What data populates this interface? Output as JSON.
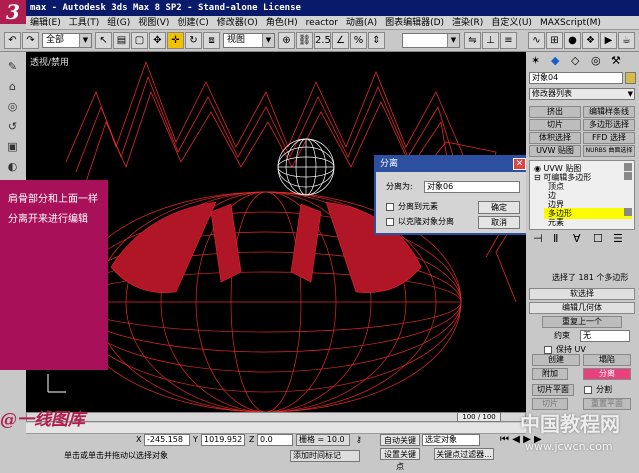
{
  "app": {
    "logo_text": "3",
    "window_title": "max - Autodesk 3ds Max 8 SP2  - Stand-alone License"
  },
  "menu": [
    "编辑(E)",
    "工具(T)",
    "组(G)",
    "视图(V)",
    "创建(C)",
    "修改器(O)",
    "角色(H)",
    "reactor",
    "动画(A)",
    "图表编辑器(D)",
    "渲染(R)",
    "自定义(U)",
    "MAXScript(M)",
    "帮助(H)"
  ],
  "toolbar": {
    "selection_filter": "全部",
    "view_select": "视图",
    "snap_label": "2.5"
  },
  "viewport": {
    "label": "透视/禁用"
  },
  "note": {
    "lines": [
      "肩骨部分和上面一样",
      "分离开来进行编辑"
    ]
  },
  "dialog": {
    "title": "分离",
    "name_label": "分离为:",
    "name_value": "对象06",
    "option_element": "分离到元素",
    "option_clone": "以克隆对象分离",
    "ok_label": "确定",
    "cancel_label": "取消"
  },
  "panel": {
    "object_name": "对象04",
    "modifier_list": "修改器列表",
    "buttons": [
      [
        "挤出",
        "编辑样条线"
      ],
      [
        "切片",
        "多边形选择"
      ],
      [
        "体积选择",
        "FFD 选择"
      ],
      [
        "UVW 贴图",
        "NURBS 曲面选择"
      ]
    ],
    "stack": [
      "UVW 贴图",
      "可编辑多边形",
      "顶点",
      "边",
      "边界",
      "多边形",
      "元素"
    ],
    "selected_status": "选择了 181 个多边形",
    "soft_selection": "软选择",
    "edit_geometry": "编辑几何体",
    "repeat_last": "重复上一个",
    "constraint_label": "约束",
    "constraint_value": "无",
    "preserve_uv": "保持 UV",
    "create_label": "创建",
    "collapse_label": "塌陷",
    "attach_label": "附加",
    "detach_label": "分离",
    "slice_plane": "切片平面",
    "split_label": "分割",
    "slice_label": "切片",
    "reset_plane": "重置平面"
  },
  "bottom": {
    "timeline": "100 / 100",
    "x_label": "X",
    "x_value": "-245.158",
    "y_label": "Y",
    "y_value": "1019.952",
    "z_label": "Z",
    "z_value": "0.0",
    "grid_label": "栅格 = 10.0",
    "autokey_label": "自动关键点",
    "autokey_value": "选定对象",
    "setkey_label": "设置关键点",
    "keyfilter_label": "关键点过滤器...",
    "status_text": "单击或单击并拖动以选择对象",
    "add_tag": "添加时间标记"
  },
  "watermarks": {
    "left": "@一线图库",
    "right_cn": "中国教程网",
    "right_url": "www.jcwcn.com"
  },
  "colors": {
    "accent": "#b01d4f",
    "wireframe": "#e0282a",
    "highlight": "#fcfc00",
    "dialog_title": "#2d4fa0"
  }
}
